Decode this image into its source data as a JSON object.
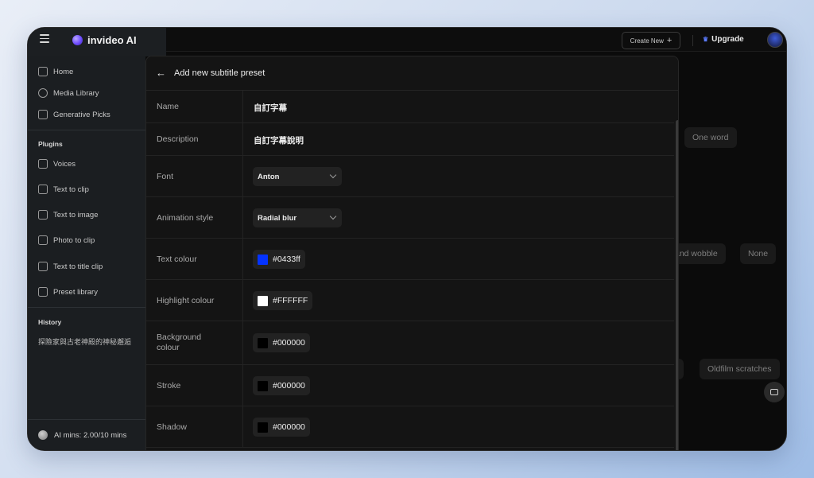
{
  "app": {
    "brand": "invideo AI",
    "create_new": "Create New",
    "upgrade": "Upgrade"
  },
  "sidebar": {
    "nav": [
      {
        "label": "Home",
        "icon": "home-grid-icon"
      },
      {
        "label": "Media Library",
        "icon": "media-library-icon"
      },
      {
        "label": "Generative Picks",
        "icon": "generative-picks-icon"
      }
    ],
    "plugins_heading": "Plugins",
    "plugins": [
      {
        "label": "Voices",
        "icon": "voices-icon"
      },
      {
        "label": "Text to clip",
        "icon": "text-to-clip-icon"
      },
      {
        "label": "Text to image",
        "icon": "text-to-image-icon"
      },
      {
        "label": "Photo to clip",
        "icon": "photo-to-clip-icon"
      },
      {
        "label": "Text to title clip",
        "icon": "text-to-title-clip-icon"
      },
      {
        "label": "Preset library",
        "icon": "preset-library-icon"
      }
    ],
    "history_heading": "History",
    "history": [
      "探險家與古老神殿的神秘邂逅"
    ],
    "ai_mins": "AI mins: 2.00/10 mins"
  },
  "background": {
    "chips": [
      "One word",
      "and wobble",
      "None",
      "s",
      "Oldfilm scratches"
    ]
  },
  "modal": {
    "title": "Add new subtitle preset",
    "fields": {
      "name": {
        "label": "Name",
        "value": "自訂字幕"
      },
      "description": {
        "label": "Description",
        "value": "自訂字幕說明"
      },
      "font": {
        "label": "Font",
        "value": "Anton"
      },
      "animation_style": {
        "label": "Animation style",
        "value": "Radial blur"
      },
      "text_colour": {
        "label": "Text colour",
        "value": "#0433ff",
        "color": "#0433ff"
      },
      "highlight_colour": {
        "label": "Highlight colour",
        "value": "#FFFFFF",
        "color": "#FFFFFF"
      },
      "background_colour": {
        "label": "Background colour",
        "value": "#000000",
        "color": "#000000"
      },
      "stroke": {
        "label": "Stroke",
        "value": "#000000",
        "color": "#000000"
      },
      "shadow": {
        "label": "Shadow",
        "value": "#000000",
        "color": "#000000"
      }
    }
  }
}
